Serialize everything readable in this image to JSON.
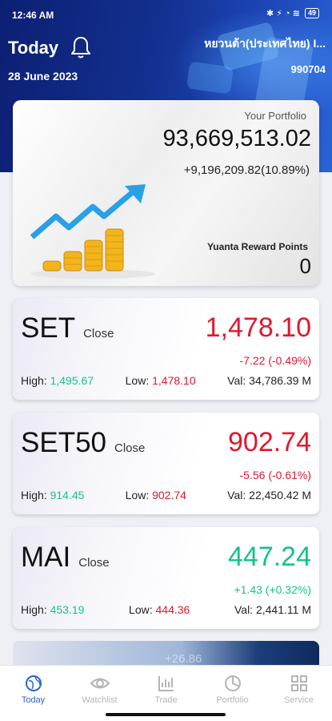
{
  "status_bar": {
    "time": "12:46 AM",
    "icons": "✱ ⚡ ◔ ≋",
    "battery": "49"
  },
  "header": {
    "title": "Today",
    "date": "28 June 2023",
    "account_name": "หยวนต้า(ประเทศไทย) I...",
    "account_number": "990704"
  },
  "portfolio": {
    "label": "Your Portfolio",
    "value": "93,669,513.02",
    "change": "+9,196,209.82(10.89%)",
    "reward_label": "Yuanta Reward Points",
    "reward_points": "0"
  },
  "indices": [
    {
      "name": "SET",
      "status": "Close",
      "value": "1,478.10",
      "change": "-7.22 (-0.49%)",
      "high_label": "High:",
      "high": "1,495.67",
      "low_label": "Low:",
      "low": "1,478.10",
      "val_label": "Val:",
      "val": "34,786.39 M"
    },
    {
      "name": "SET50",
      "status": "Close",
      "value": "902.74",
      "change": "-5.56 (-0.61%)",
      "high_label": "High:",
      "high": "914.45",
      "low_label": "Low:",
      "low": "902.74",
      "val_label": "Val:",
      "val": "22,450.42 M"
    },
    {
      "name": "MAI",
      "status": "Close",
      "value": "447.24",
      "change": "+1.43 (+0.32%)",
      "high_label": "High:",
      "high": "453.19",
      "low_label": "Low:",
      "low": "444.36",
      "val_label": "Val:",
      "val": "2,441.11 M"
    }
  ],
  "banner": {
    "text": "+26.86"
  },
  "tabs": [
    {
      "label": "Today",
      "icon": "globe-icon"
    },
    {
      "label": "Watchlist",
      "icon": "eye-icon"
    },
    {
      "label": "Trade",
      "icon": "chart-icon"
    },
    {
      "label": "Portfolio",
      "icon": "pie-icon"
    },
    {
      "label": "Service",
      "icon": "grid-icon"
    }
  ],
  "colors": {
    "header": "#13308f",
    "down": "#e0182d",
    "up": "#16c28e",
    "active_tab": "#2f66c8"
  }
}
